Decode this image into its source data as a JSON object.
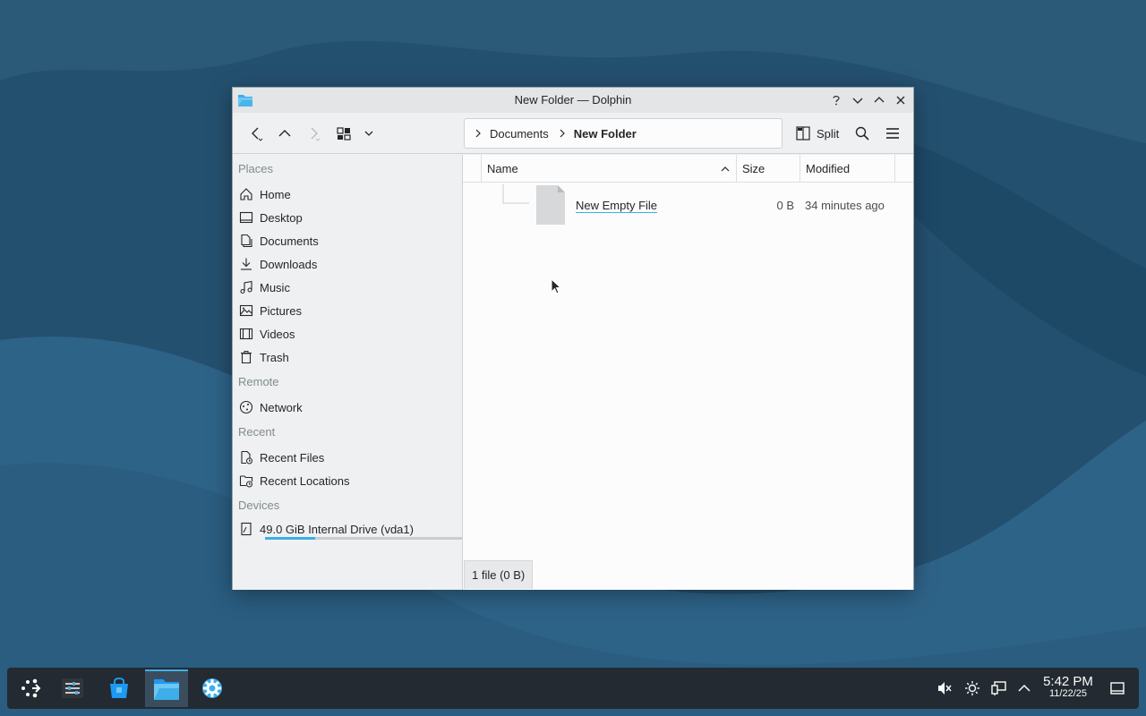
{
  "window": {
    "title": "New Folder — Dolphin"
  },
  "breadcrumb": {
    "items": [
      "Documents",
      "New Folder"
    ]
  },
  "toolbar": {
    "split_label": "Split"
  },
  "sidebar": {
    "sections": {
      "places": "Places",
      "remote": "Remote",
      "recent": "Recent",
      "devices": "Devices"
    },
    "places": [
      {
        "label": "Home",
        "icon": "home-icon"
      },
      {
        "label": "Desktop",
        "icon": "desktop-icon"
      },
      {
        "label": "Documents",
        "icon": "documents-icon"
      },
      {
        "label": "Downloads",
        "icon": "downloads-icon"
      },
      {
        "label": "Music",
        "icon": "music-icon"
      },
      {
        "label": "Pictures",
        "icon": "pictures-icon"
      },
      {
        "label": "Videos",
        "icon": "videos-icon"
      },
      {
        "label": "Trash",
        "icon": "trash-icon"
      }
    ],
    "remote": [
      {
        "label": "Network",
        "icon": "network-icon"
      }
    ],
    "recent": [
      {
        "label": "Recent Files",
        "icon": "recent-files-icon"
      },
      {
        "label": "Recent Locations",
        "icon": "recent-locations-icon"
      }
    ],
    "devices": [
      {
        "label": "49.0 GiB Internal Drive (vda1)",
        "icon": "drive-icon",
        "usage_fraction": 0.25
      }
    ]
  },
  "columns": {
    "name": "Name",
    "size": "Size",
    "modified": "Modified"
  },
  "files": [
    {
      "name": "New Empty File",
      "size": "0 B",
      "modified": "34 minutes ago"
    }
  ],
  "status": {
    "text": "1 file (0 B)"
  },
  "taskbar": {
    "time": "5:42 PM",
    "date": "11/22/25"
  },
  "colors": {
    "accent": "#3daee9",
    "taskbar": "#232a31",
    "window_bg": "#eff0f1"
  }
}
